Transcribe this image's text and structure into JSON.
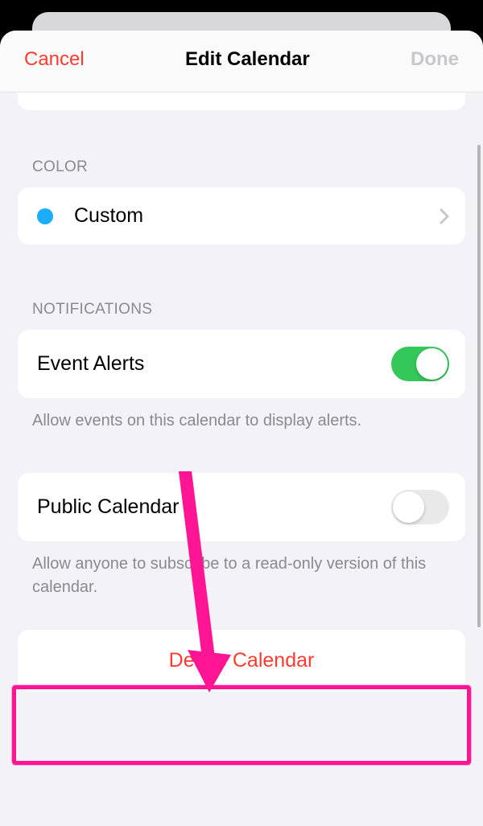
{
  "navbar": {
    "cancel": "Cancel",
    "title": "Edit Calendar",
    "done": "Done"
  },
  "sections": {
    "color": {
      "header": "COLOR",
      "row_label": "Custom",
      "dot_color": "#1badf8"
    },
    "notifications": {
      "header": "NOTIFICATIONS",
      "event_alerts_label": "Event Alerts",
      "event_alerts_on": true,
      "event_alerts_footer": "Allow events on this calendar to display alerts.",
      "public_calendar_label": "Public Calendar",
      "public_calendar_on": false,
      "public_calendar_footer": "Allow anyone to subscribe to a read-only version of this calendar."
    },
    "delete": {
      "label": "Delete Calendar"
    }
  },
  "annotation": {
    "highlight_color": "#ff1493",
    "arrow_color": "#ff1493"
  }
}
